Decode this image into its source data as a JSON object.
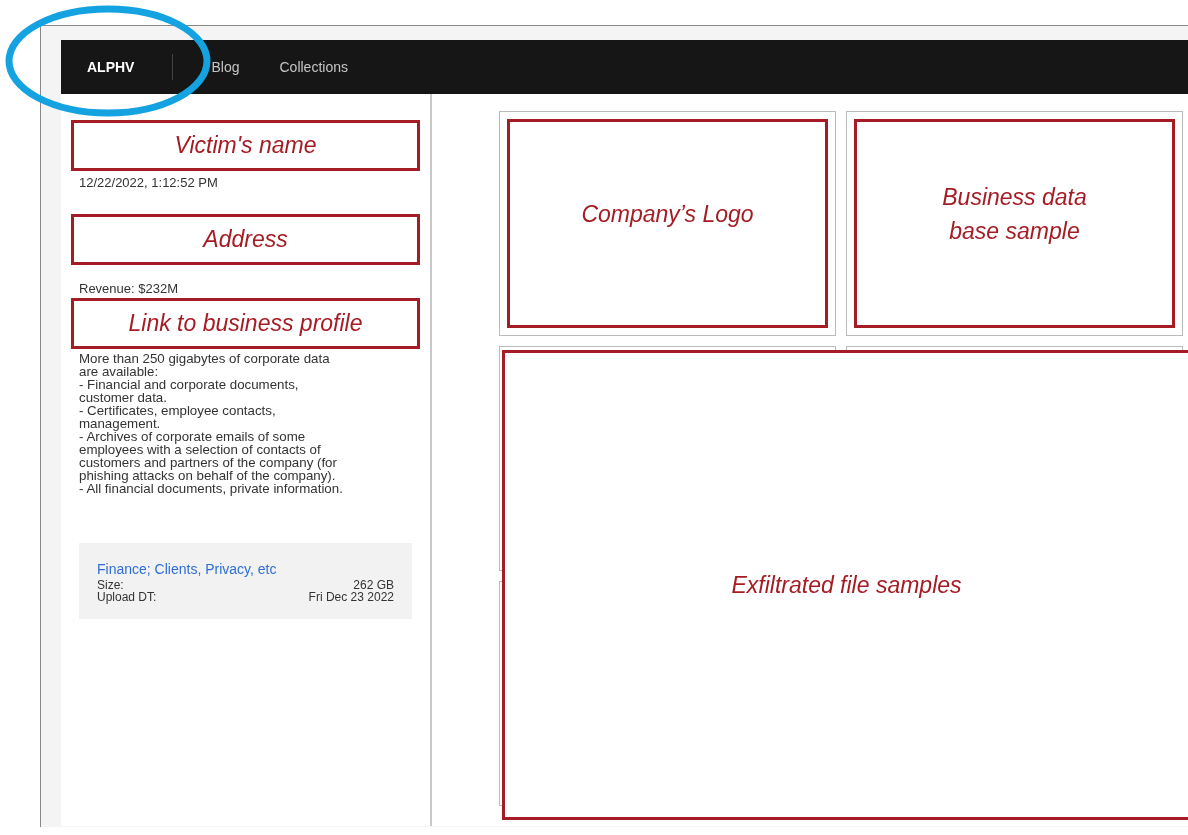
{
  "nav": {
    "brand": "ALPHV",
    "links": [
      {
        "label": "Blog"
      },
      {
        "label": "Collections"
      }
    ]
  },
  "post": {
    "name_note": "Victim's name",
    "date": "12/22/2022, 1:12:52 PM",
    "address_note": "Address",
    "revenue": "Revenue: $232M",
    "profile_note": "Link to business profile",
    "description": "More than 250 gigabytes of corporate data\nare available:\n- Financial and corporate documents,\ncustomer data.\n- Certificates, employee contacts,\nmanagement.\n- Archives of corporate emails of some\nemployees with a selection of contacts of\ncustomers and partners of the company (for\nphishing attacks on behalf of the company).\n- All financial documents, private information.",
    "files": {
      "link": "Finance; Clients, Privacy, etc",
      "rows": [
        {
          "label": "Size:",
          "value": "262 GB"
        },
        {
          "label": "Upload DT:",
          "value": "Fri Dec 23 2022"
        }
      ]
    }
  },
  "gallery": {
    "tiles": [
      {
        "note": "Company’s Logo"
      },
      {
        "note": "Business data\nbase sample"
      }
    ],
    "overlay_note": "Exfiltrated file samples"
  }
}
